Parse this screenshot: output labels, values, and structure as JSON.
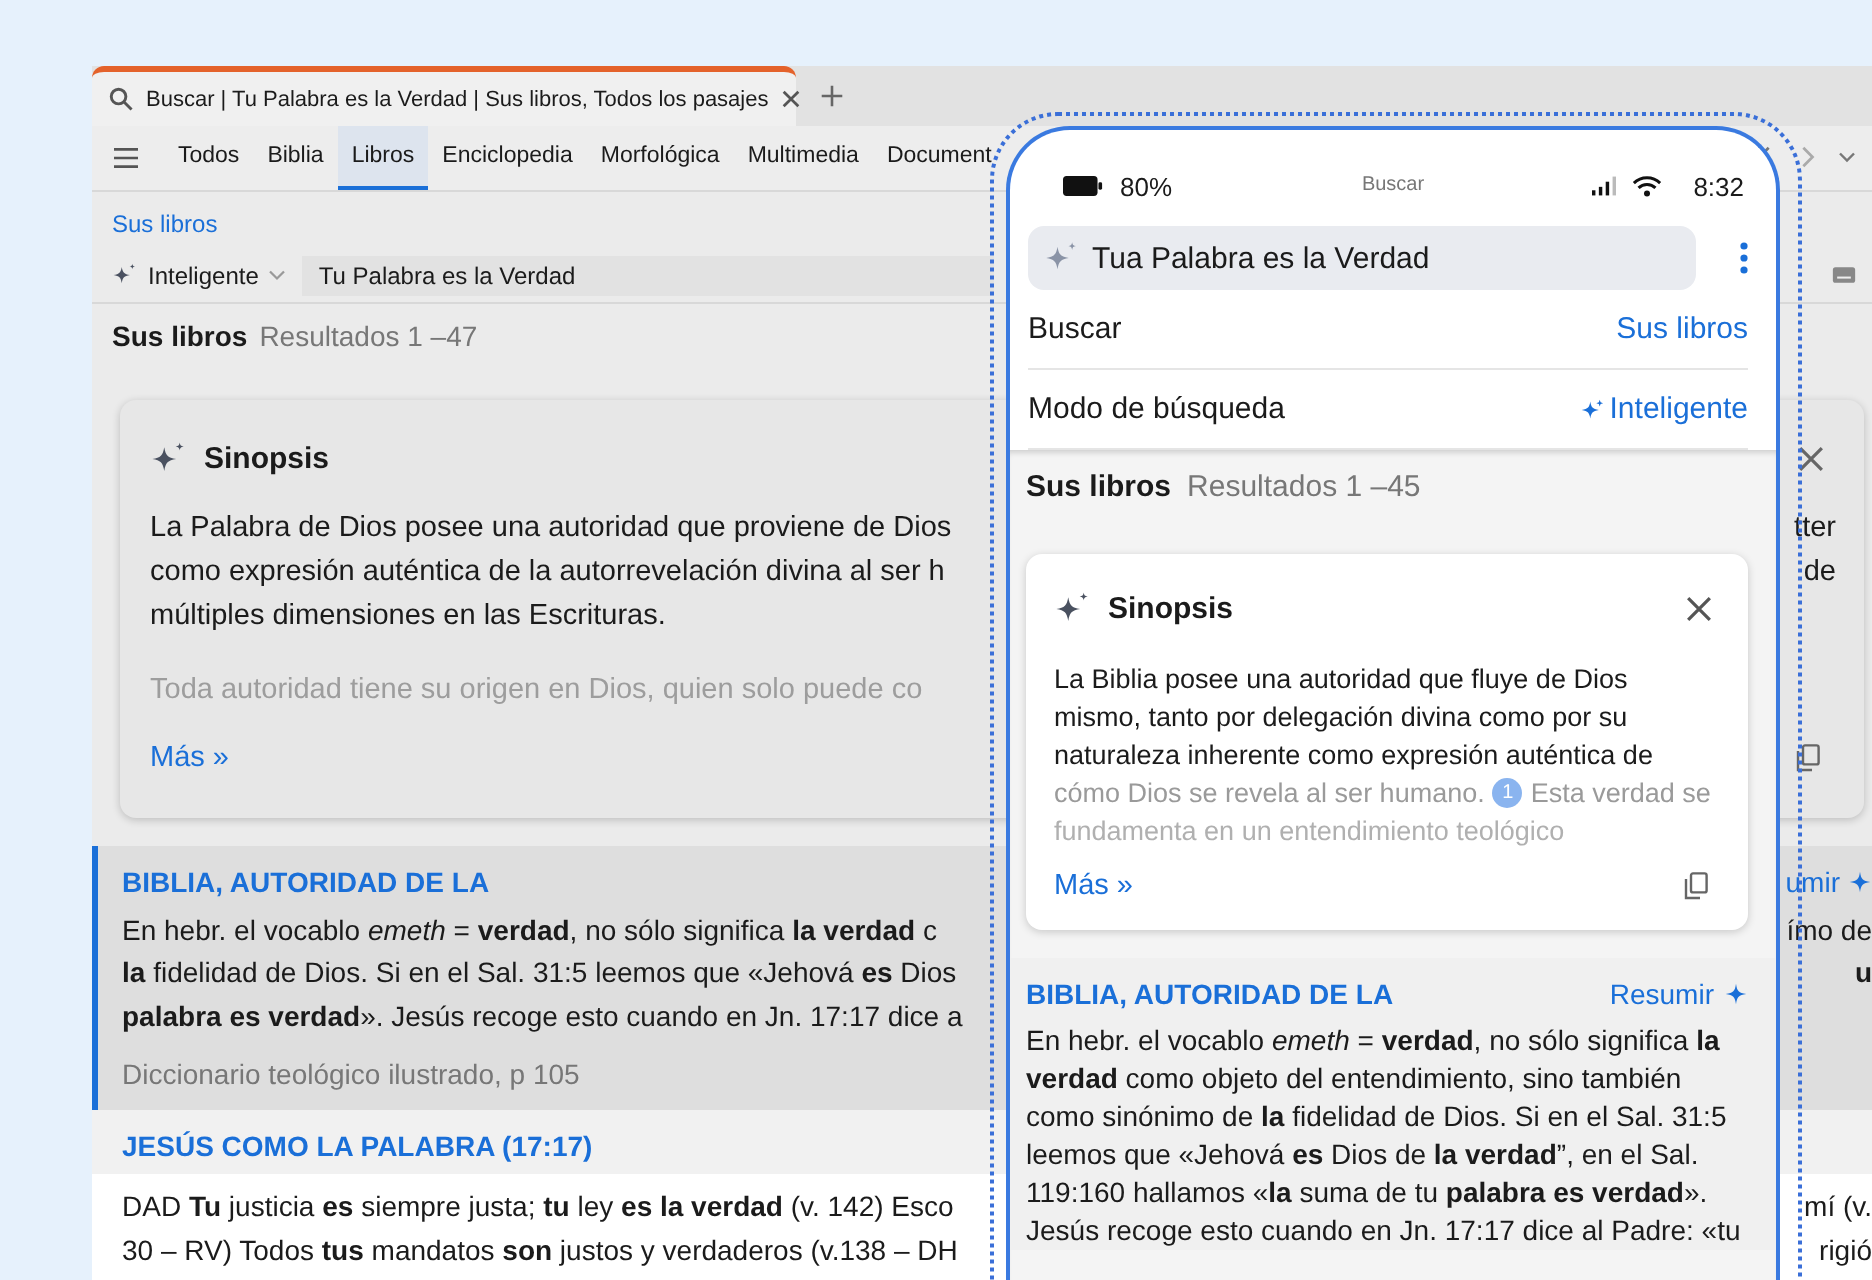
{
  "desktop": {
    "tab_title": "Buscar | Tu Palabra es la Verdad | Sus libros, Todos los pasajes",
    "nav_tabs": [
      {
        "label": "Todos",
        "selected": false
      },
      {
        "label": "Biblia",
        "selected": false
      },
      {
        "label": "Libros",
        "selected": true
      },
      {
        "label": "Enciclopedia",
        "selected": false
      },
      {
        "label": "Morfológica",
        "selected": false
      },
      {
        "label": "Multimedia",
        "selected": false
      },
      {
        "label": "Document",
        "selected": false
      }
    ],
    "breadcrumb": "Sus libros",
    "mode": "Inteligente",
    "query": "Tu Palabra es la Verdad",
    "results_title": "Sus libros",
    "results_count": "Resultados 1 –47",
    "synopsis": {
      "title": "Sinopsis",
      "lines": [
        {
          "left": "La Palabra de Dios posee una autoridad que proviene de Dios",
          "right": "tter"
        },
        {
          "left": "como expresión auténtica de la autorrevelación divina al ser h",
          "right": "de"
        },
        {
          "left": "múltiples dimensiones en las Escrituras."
        }
      ],
      "faded": "Toda autoridad tiene su origen en Dios, quien solo puede co",
      "more": "Más »"
    },
    "entries": [
      {
        "heading": "BIBLIA, AUTORIDAD DE LA",
        "selected": true,
        "action": "umir",
        "lines": [
          {
            "left": "En hebr. el vocablo *emeth* = **verdad**, no sólo significa **la verdad** c",
            "right": "ímo de"
          },
          {
            "left": "**la** fidelidad de Dios. Si en el Sal. 31:5 leemos que «Jehová **es** Dios",
            "right": "**u**"
          },
          {
            "left": "**palabra es verdad**». Jesús recoge esto cuando en Jn. 17:17 dice a"
          }
        ],
        "source": "Diccionario teológico ilustrado, p 105"
      },
      {
        "heading": "JESÚS COMO LA PALABRA (17:17)",
        "selected": false,
        "lines": [
          {
            "left": "DAD **Tu** justicia **es** siempre justa; **tu** ley **es la verdad** (v. 142) Esco",
            "right": "mí (v."
          },
          {
            "left": "30 – RV) Todos **tus** mandatos **son** justos y verdaderos (v.138 – DH",
            "right": "rigió"
          }
        ]
      }
    ]
  },
  "phone": {
    "battery": "80%",
    "screen_title": "Buscar",
    "time": "8:32",
    "query": "Tua Palabra es la Verdad",
    "settings": [
      {
        "label": "Buscar",
        "value": "Sus libros",
        "kind": "plain"
      },
      {
        "label": "Modo de búsqueda",
        "value": "Inteligente",
        "kind": "smart"
      }
    ],
    "results_title": "Sus libros",
    "results_count": "Resultados 1 –45",
    "synopsis": {
      "title": "Sinopsis",
      "text": "La Biblia posee una autoridad que fluye de Dios mismo, tanto por delegación divina como por su naturaleza inherente como expresión auténtica de",
      "faded": "cómo Dios se revela al ser humano.",
      "badge": "1",
      "faded_tail": "Esta verdad se",
      "faded_last": "fundamenta en un entendimiento teológico",
      "more": "Más »"
    },
    "entry": {
      "heading": "BIBLIA, AUTORIDAD DE LA",
      "action": "Resumir",
      "text": "En hebr. el vocablo *emeth* = **verdad**, no sólo significa **la verdad** como objeto del entendimiento, sino también como sinónimo de **la** fidelidad de Dios. Si en el Sal. 31:5 leemos que «Jehová **es** Dios de **la verdad**”, en el Sal. 119:160 hallamos «**la** suma de tu **palabra es verdad**». Jesús recoge esto cuando en Jn. 17:17 dice al Padre: «tu"
    }
  }
}
